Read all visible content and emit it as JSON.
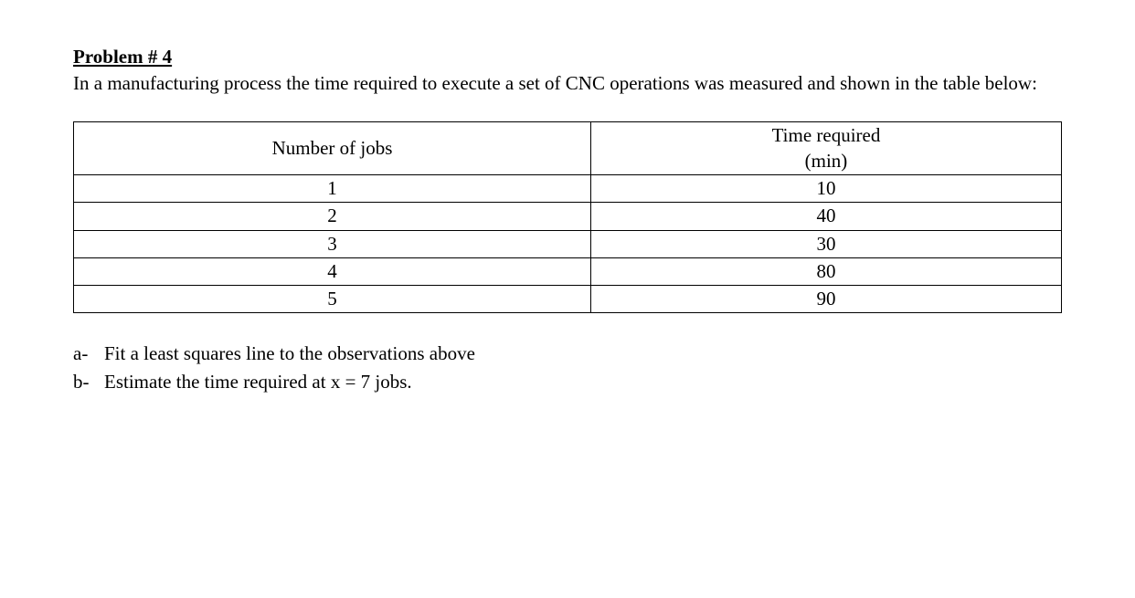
{
  "problem": {
    "title": "Problem # 4",
    "text": "In a manufacturing process the time required to execute a set of CNC operations was measured and shown in the table below:"
  },
  "table": {
    "headers": {
      "col1": "Number of jobs",
      "col2_line1": "Time required",
      "col2_line2": "(min)"
    },
    "rows": [
      {
        "jobs": "1",
        "time": "10"
      },
      {
        "jobs": "2",
        "time": "40"
      },
      {
        "jobs": "3",
        "time": "30"
      },
      {
        "jobs": "4",
        "time": "80"
      },
      {
        "jobs": "5",
        "time": "90"
      }
    ]
  },
  "questions": {
    "a": {
      "label": "a-",
      "text": "Fit a least squares line to the observations above"
    },
    "b": {
      "label": "b-",
      "text": "Estimate the time required at x = 7 jobs."
    }
  },
  "chart_data": {
    "type": "table",
    "columns": [
      "Number of jobs",
      "Time required (min)"
    ],
    "data": [
      [
        1,
        10
      ],
      [
        2,
        40
      ],
      [
        3,
        30
      ],
      [
        4,
        80
      ],
      [
        5,
        90
      ]
    ]
  }
}
